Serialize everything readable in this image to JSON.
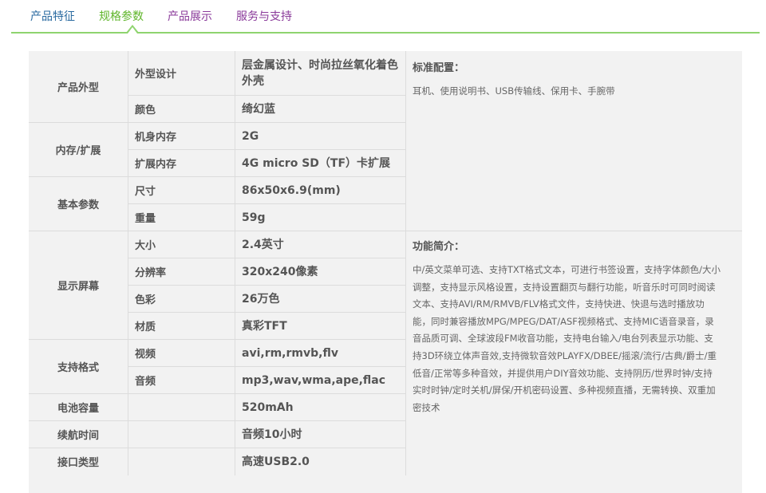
{
  "tabs": [
    {
      "label": "产品特征",
      "active": false
    },
    {
      "label": "规格参数",
      "active": true
    },
    {
      "label": "产品展示",
      "active": false
    },
    {
      "label": "服务与支持",
      "active": false
    }
  ],
  "colors": {
    "accent": "#8fd46f",
    "tab_active": "#5fb52a",
    "tab_blue": "#2a6aa0",
    "tab_purple": "#8a3a9a",
    "panel": "#f2f2f2"
  },
  "specs": {
    "appearance": {
      "category": "产品外型",
      "design": {
        "label": "外型设计",
        "value": "层金属设计、时尚拉丝氧化着色外壳"
      },
      "color": {
        "label": "颜色",
        "value": "绮幻蓝"
      }
    },
    "memory": {
      "category": "内存/扩展",
      "internal": {
        "label": "机身内存",
        "value": "2G"
      },
      "expansion": {
        "label": "扩展内存",
        "value": "4G micro SD（TF）卡扩展"
      }
    },
    "basic": {
      "category": "基本参数",
      "size": {
        "label": "尺寸",
        "value": "86x50x6.9(mm)"
      },
      "weight": {
        "label": "重量",
        "value": "59g"
      }
    },
    "screen": {
      "category": "显示屏幕",
      "size": {
        "label": "大小",
        "value": "2.4英寸"
      },
      "resolution": {
        "label": "分辨率",
        "value": "320x240像素"
      },
      "colors": {
        "label": "色彩",
        "value": "26万色"
      },
      "material": {
        "label": "材质",
        "value": "真彩TFT"
      }
    },
    "formats": {
      "category": "支持格式",
      "video": {
        "label": "视频",
        "value": "avi,rm,rmvb,flv"
      },
      "audio": {
        "label": "音频",
        "value": "mp3,wav,wma,ape,flac"
      }
    },
    "battery": {
      "category": "电池容量",
      "value": "520mAh"
    },
    "endurance": {
      "category": "续航时间",
      "value": "音频10小时"
    },
    "interface": {
      "category": "接口类型",
      "value": "高速USB2.0"
    }
  },
  "side": {
    "standard_title": "标准配置：",
    "standard_text": "耳机、使用说明书、USB传输线、保用卡、手腕带",
    "features_title": "功能简介：",
    "features_lines": [
      "中/英文菜单可选、支持TXT格式文本，可进行书签设置，支持字体颜色/大小",
      "调整，支持显示风格设置，支持设置翻页与翻行功能，听音乐时可同时阅读",
      "文本、支持AVI/RM/RMVB/FLV格式文件，支持快进、快退与选时播放功",
      "能，同时兼容播放MPG/MPEG/DAT/ASF视频格式、支持MIC语音录音，录",
      "音品质可调、全球波段FM收音功能，支持电台输入/电台列表显示功能、支",
      "持3D环绕立体声音效,支持微软音效PLAYFX/DBEE/摇滚/流行/古典/爵士/重",
      "低音/正常等多种音效，并提供用户DIY音效功能、支持阴历/世界时钟/支持",
      "实时时钟/定时关机/屏保/开机密码设置、多种视频直播，无需转换、双重加",
      "密技术"
    ]
  }
}
